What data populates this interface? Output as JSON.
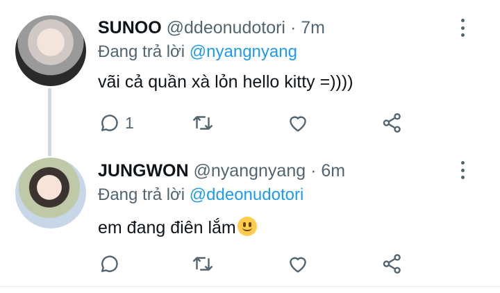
{
  "tweets": [
    {
      "name": "SUNOO",
      "handle": "@ddeonudotori",
      "separator": "·",
      "time": "7m",
      "reply_prefix": "Đang trả lời",
      "reply_to": "@nyangnyang",
      "text": "vãi cả quần xà lỏn hello kitty =))))",
      "reply_count": "1"
    },
    {
      "name": "JUNGWON",
      "handle": "@nyangnyang",
      "separator": "·",
      "time": "6m",
      "reply_prefix": "Đang trả lời",
      "reply_to": "@ddeonudotori",
      "text": "em đang điên lắm",
      "reply_count": ""
    }
  ],
  "icons": [
    "reply-icon",
    "retweet-icon",
    "like-icon",
    "share-icon",
    "more-options-icon",
    "slightly-smiling-emoji-icon"
  ],
  "colors": {
    "text": "#0f1419",
    "secondary": "#536471",
    "mention": "#1d9bf0",
    "thread_line": "#cfd9de"
  }
}
